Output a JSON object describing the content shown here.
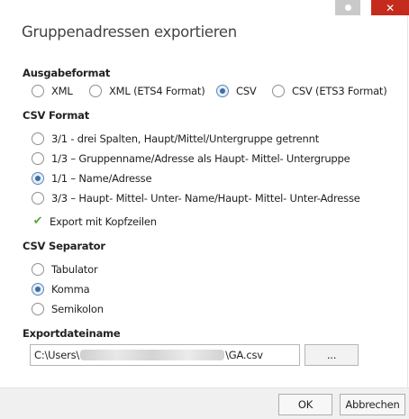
{
  "window": {
    "title": "Gruppenadressen exportieren"
  },
  "ausgabeformat": {
    "label": "Ausgabeformat",
    "options": [
      {
        "label": "XML",
        "checked": false
      },
      {
        "label": "XML (ETS4 Format)",
        "checked": false
      },
      {
        "label": "CSV",
        "checked": true
      },
      {
        "label": "CSV (ETS3 Format)",
        "checked": false
      }
    ]
  },
  "csv_format": {
    "label": "CSV Format",
    "options": [
      {
        "label": "3/1 - drei Spalten, Haupt/Mittel/Untergruppe getrennt",
        "checked": false
      },
      {
        "label": "1/3 – Gruppenname/Adresse als Haupt- Mittel- Untergruppe",
        "checked": false
      },
      {
        "label": "1/1 – Name/Adresse",
        "checked": true
      },
      {
        "label": "3/3 – Haupt- Mittel- Unter- Name/Haupt- Mittel- Unter-Adresse",
        "checked": false
      }
    ],
    "header_checkbox": {
      "label": "Export mit Kopfzeilen",
      "checked": true
    }
  },
  "csv_separator": {
    "label": "CSV Separator",
    "options": [
      {
        "label": "Tabulator",
        "checked": false
      },
      {
        "label": "Komma",
        "checked": true
      },
      {
        "label": "Semikolon",
        "checked": false
      }
    ]
  },
  "export_file": {
    "label": "Exportdateiname",
    "path_prefix": "C:\\Users\\",
    "path_suffix": "\\GA.csv",
    "browse_label": "..."
  },
  "footer": {
    "ok_label": "OK",
    "cancel_label": "Abbrechen"
  },
  "colors": {
    "close_button": "#c42b1c",
    "accent": "#3d6ea6",
    "check": "#55a640"
  }
}
